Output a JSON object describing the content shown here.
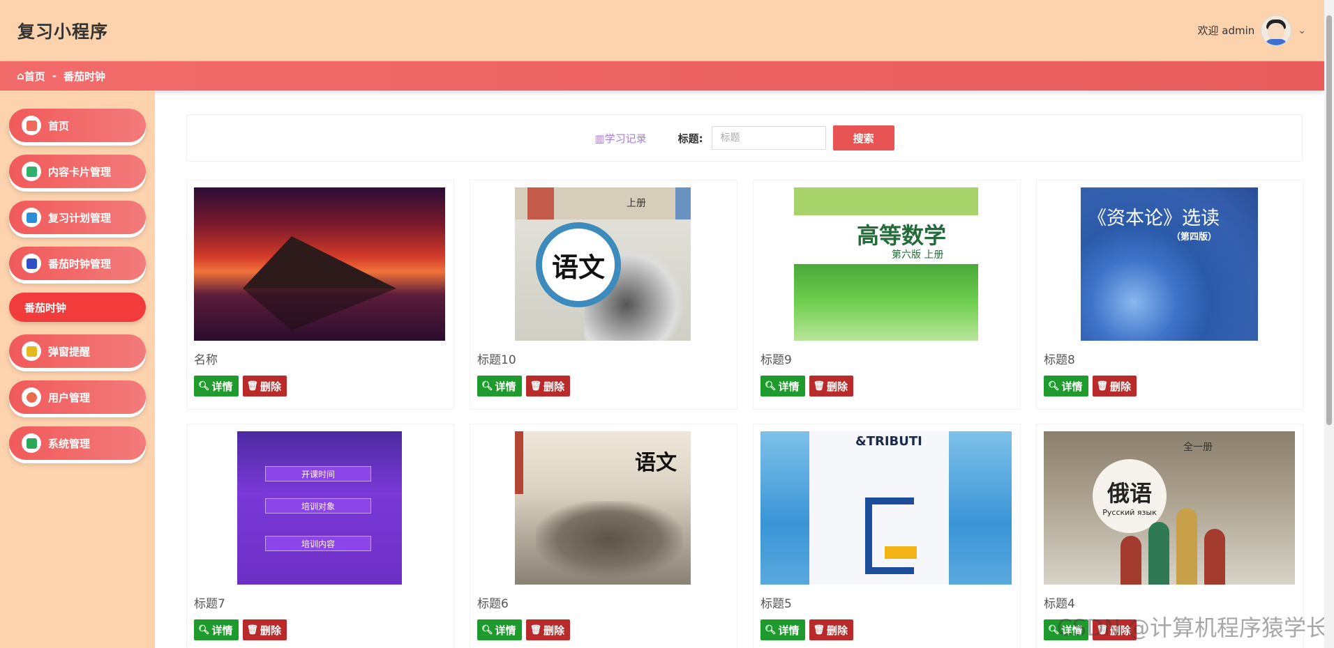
{
  "header": {
    "app_title": "复习小程序",
    "welcome_text": "欢迎 admin"
  },
  "breadcrumb": {
    "home": "首页",
    "separator": "-",
    "current": "番茄时钟"
  },
  "sidebar": {
    "items": [
      {
        "label": "首页",
        "icon": "home-icon",
        "color": "#f06a5a"
      },
      {
        "label": "内容卡片管理",
        "icon": "card-icon",
        "color": "#31b06b"
      },
      {
        "label": "复习计划管理",
        "icon": "plan-icon",
        "color": "#2d8bd8"
      },
      {
        "label": "番茄时钟管理",
        "icon": "clock-icon",
        "color": "#2f4fc4"
      },
      {
        "label": "番茄时钟",
        "icon": "",
        "color": ""
      },
      {
        "label": "弹窗提醒",
        "icon": "popup-icon",
        "color": "#e5b81f"
      },
      {
        "label": "用户管理",
        "icon": "user-icon",
        "color": "#e96c50"
      },
      {
        "label": "系统管理",
        "icon": "system-icon",
        "color": "#2aa85a"
      }
    ]
  },
  "search": {
    "tab_label": "学习记录",
    "field_label": "标题:",
    "placeholder": "标题",
    "button_label": "搜索"
  },
  "cards": [
    {
      "title": "名称"
    },
    {
      "title": "标题10"
    },
    {
      "title": "标题9"
    },
    {
      "title": "标题8"
    },
    {
      "title": "标题7"
    },
    {
      "title": "标题6"
    },
    {
      "title": "标题5"
    },
    {
      "title": "标题4"
    }
  ],
  "card_actions": {
    "detail_label": "详情",
    "delete_label": "删除"
  },
  "watermark": "CSDN @计算机程序猿学长",
  "colors": {
    "header_bg": "#fdd3ae",
    "accent": "#e85454",
    "detail_btn": "#1e9b2c",
    "delete_btn": "#b92a2a"
  }
}
